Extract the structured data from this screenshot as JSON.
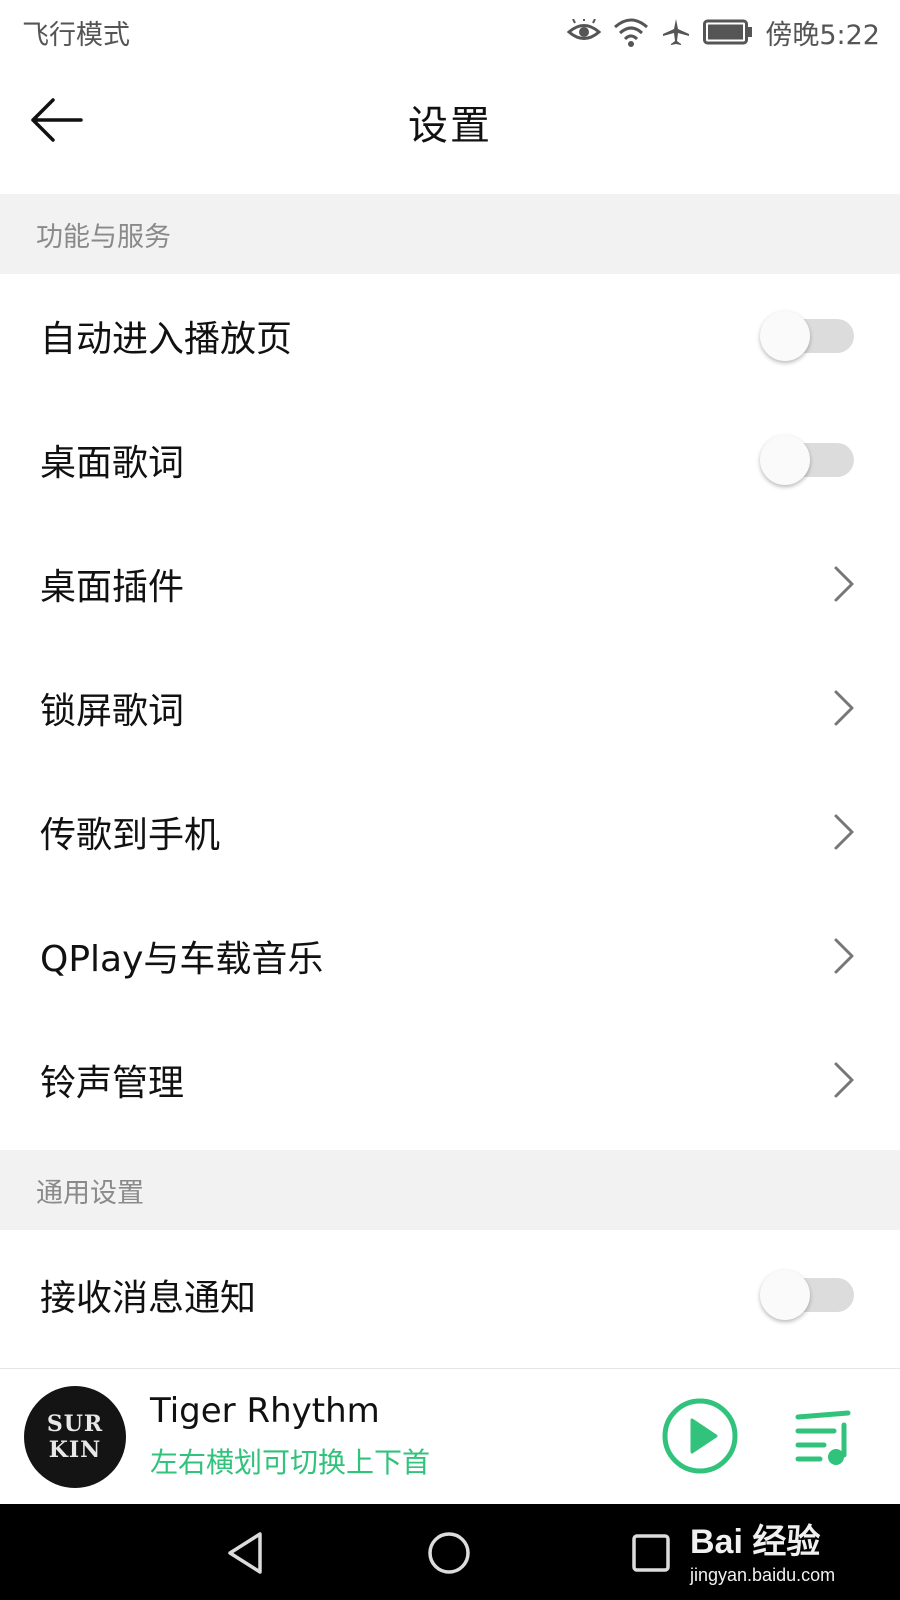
{
  "status_bar": {
    "mode_text": "飞行模式",
    "time": "傍晚5:22",
    "icons": [
      "eye-icon",
      "wifi-icon",
      "airplane-icon",
      "battery-icon"
    ]
  },
  "header": {
    "title": "设置",
    "back_icon": "back-arrow-icon"
  },
  "sections": [
    {
      "title": "功能与服务",
      "items": [
        {
          "label": "自动进入播放页",
          "control": "toggle",
          "on": false
        },
        {
          "label": "桌面歌词",
          "control": "toggle",
          "on": false
        },
        {
          "label": "桌面插件",
          "control": "chevron"
        },
        {
          "label": "锁屏歌词",
          "control": "chevron"
        },
        {
          "label": "传歌到手机",
          "control": "chevron"
        },
        {
          "label": "QPlay与车载音乐",
          "control": "chevron"
        },
        {
          "label": "铃声管理",
          "control": "chevron"
        }
      ]
    },
    {
      "title": "通用设置",
      "items": [
        {
          "label": "接收消息通知",
          "control": "toggle",
          "on": false
        }
      ]
    }
  ],
  "player": {
    "album_text_line1": "SUR",
    "album_text_line2": "KIN",
    "track_title": "Tiger Rhythm",
    "hint": "左右横划可切换上下首",
    "accent_color": "#31c27c"
  },
  "nav_bar": {
    "buttons": [
      "back-triangle-icon",
      "home-circle-icon",
      "recents-square-icon"
    ],
    "watermark_top": "Bai  经验",
    "watermark_bottom": "jingyan.baidu.com"
  }
}
